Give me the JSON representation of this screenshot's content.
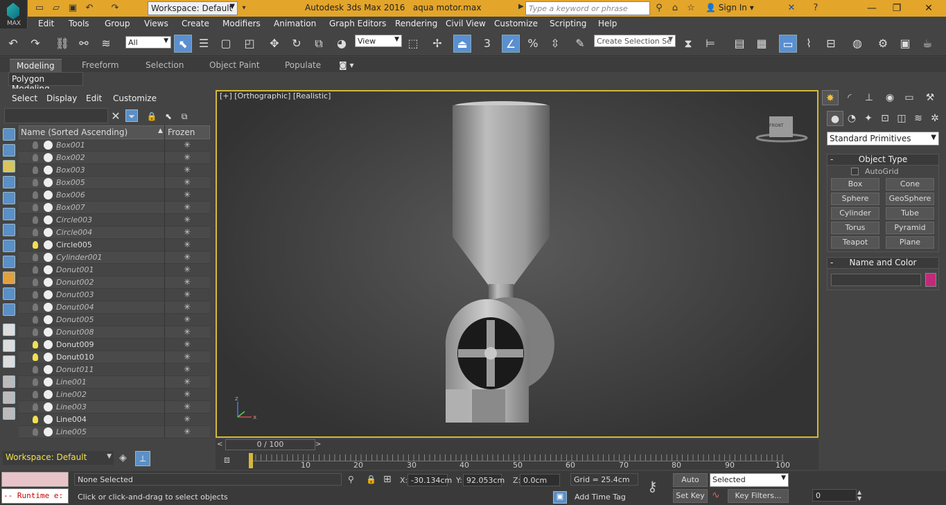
{
  "app": {
    "workspace": "Workspace: Default",
    "title": "Autodesk 3ds Max 2016",
    "filename": "aqua motor.max",
    "search_placeholder": "Type a keyword or phrase",
    "signin": "Sign In",
    "logo_text": "MAX",
    "accent_color": "#e3a52a"
  },
  "menubar": [
    "Edit",
    "Tools",
    "Group",
    "Views",
    "Create",
    "Modifiers",
    "Animation",
    "Graph Editors",
    "Rendering",
    "Civil View",
    "Customize",
    "Scripting",
    "Help"
  ],
  "toolbar": {
    "selection_filter": "All",
    "ref_coord": "View",
    "selection_set_placeholder": "Create Selection Se"
  },
  "ribbon": {
    "tabs": [
      "Modeling",
      "Freeform",
      "Selection",
      "Object Paint",
      "Populate"
    ],
    "active_tab": "Modeling",
    "panel": "Polygon Modeling"
  },
  "scene_explorer": {
    "menu": [
      "Select",
      "Display",
      "Edit",
      "Customize"
    ],
    "col_name": "Name (Sorted Ascending)",
    "col_frozen": "Frozen",
    "rows": [
      {
        "name": "Box001",
        "visible": false
      },
      {
        "name": "Box002",
        "visible": false
      },
      {
        "name": "Box003",
        "visible": false
      },
      {
        "name": "Box005",
        "visible": false
      },
      {
        "name": "Box006",
        "visible": false
      },
      {
        "name": "Box007",
        "visible": false
      },
      {
        "name": "Circle003",
        "visible": false
      },
      {
        "name": "Circle004",
        "visible": false
      },
      {
        "name": "Circle005",
        "visible": true
      },
      {
        "name": "Cylinder001",
        "visible": false
      },
      {
        "name": "Donut001",
        "visible": false
      },
      {
        "name": "Donut002",
        "visible": false
      },
      {
        "name": "Donut003",
        "visible": false
      },
      {
        "name": "Donut004",
        "visible": false
      },
      {
        "name": "Donut005",
        "visible": false
      },
      {
        "name": "Donut008",
        "visible": false
      },
      {
        "name": "Donut009",
        "visible": true
      },
      {
        "name": "Donut010",
        "visible": true
      },
      {
        "name": "Donut011",
        "visible": false
      },
      {
        "name": "Line001",
        "visible": false
      },
      {
        "name": "Line002",
        "visible": false
      },
      {
        "name": "Line003",
        "visible": false
      },
      {
        "name": "Line004",
        "visible": true
      },
      {
        "name": "Line005",
        "visible": false
      }
    ],
    "footer_workspace": "Workspace: Default"
  },
  "viewport": {
    "label": "[+] [Orthographic] [Realistic]",
    "viewcube": "FRONT",
    "border_color": "#d5b83a"
  },
  "command_panel": {
    "category": "Standard Primitives",
    "object_type_title": "Object Type",
    "autogrid": "AutoGrid",
    "buttons": [
      "Box",
      "Cone",
      "Sphere",
      "GeoSphere",
      "Cylinder",
      "Tube",
      "Torus",
      "Pyramid",
      "Teapot",
      "Plane"
    ],
    "name_color_title": "Name and Color",
    "swatch_color": "#c02a7a"
  },
  "timeline": {
    "frame": "0 / 100",
    "ticks": [
      "10",
      "20",
      "30",
      "40",
      "50",
      "60",
      "70",
      "80",
      "90",
      "100"
    ]
  },
  "status": {
    "selection": "None Selected",
    "prompt": "Click or click-and-drag to select objects",
    "x": "-30.134cm",
    "y": "92.053cm",
    "z": "0.0cm",
    "grid": "Grid = 25.4cm",
    "add_time_tag": "Add Time Tag",
    "auto_key": "Auto Key",
    "set_key": "Set Key",
    "key_mode": "Selected",
    "key_filters": "Key Filters...",
    "frame_field": "0",
    "maxscript": "-- Runtime e:"
  }
}
